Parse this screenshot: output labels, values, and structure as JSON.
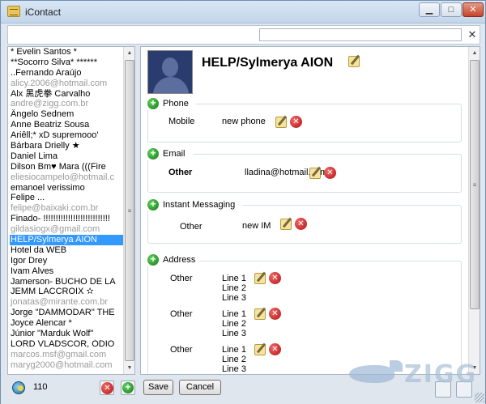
{
  "window": {
    "title": "iContact"
  },
  "search": {
    "value": "",
    "clear_icon": "close-icon"
  },
  "contacts": [
    {
      "label": "* Evelin Santos *",
      "type": "name"
    },
    {
      "label": "**Socorro Silva* ******",
      "type": "name"
    },
    {
      "label": "..Fernando Araújo",
      "type": "name"
    },
    {
      "label": "alicy.2006@hotmail.com",
      "type": "email"
    },
    {
      "label": "Alx 黑虎拳 Carvalho",
      "type": "name"
    },
    {
      "label": "andre@zigg.com.br",
      "type": "email"
    },
    {
      "label": "Ângelo Sednem",
      "type": "name"
    },
    {
      "label": "Anne Beatriz Sousa",
      "type": "name"
    },
    {
      "label": "Ariêll;* xD supremooo'",
      "type": "name"
    },
    {
      "label": "Bárbara Drielly ★",
      "type": "name"
    },
    {
      "label": "Daniel Lima",
      "type": "name"
    },
    {
      "label": "Dilson Bm♥ Mara (((Fire",
      "type": "name"
    },
    {
      "label": "eliesiocampelo@hotmail.c",
      "type": "email"
    },
    {
      "label": "emanoel verissimo",
      "type": "name"
    },
    {
      "label": "Felipe ...",
      "type": "name"
    },
    {
      "label": "felipe@baixaki.com.br",
      "type": "email"
    },
    {
      "label": "Finado- !!!!!!!!!!!!!!!!!!!!!!!!!!!",
      "type": "name"
    },
    {
      "label": "gildasiogx@gmail.com",
      "type": "email"
    },
    {
      "label": "HELP/Sylmerya AION",
      "type": "selected"
    },
    {
      "label": "Hotel da WEB",
      "type": "name"
    },
    {
      "label": "Igor Drey",
      "type": "name"
    },
    {
      "label": "Ivam Alves",
      "type": "name"
    },
    {
      "label": "Jamerson- BUCHO DE LA",
      "type": "name"
    },
    {
      "label": "JEMM LACCROIX ✫",
      "type": "name"
    },
    {
      "label": "jonatas@mirante.com.br",
      "type": "email"
    },
    {
      "label": "Jorge \"DAMMODAR\" THE",
      "type": "name"
    },
    {
      "label": "Joyce Alencar *",
      "type": "name"
    },
    {
      "label": "Júnior \"Marduk Wolf\"",
      "type": "name"
    },
    {
      "label": "LORD VLADSCOR, ÓDIO",
      "type": "name"
    },
    {
      "label": "marcos.msf@gmail.com",
      "type": "email"
    },
    {
      "label": "maryg2000@hotmail.com",
      "type": "email"
    }
  ],
  "detail": {
    "name": "HELP/Sylmerya AION",
    "sections": {
      "phone": {
        "title": "Phone",
        "label": "Mobile",
        "value": "new phone"
      },
      "email": {
        "title": "Email",
        "label": "Other",
        "value": "lladina@hotmail.com"
      },
      "im": {
        "title": "Instant Messaging",
        "label": "Other",
        "value": "new IM"
      },
      "address": {
        "title": "Address",
        "entries": [
          {
            "label": "Other",
            "line1": "Line 1",
            "line2": "Line 2",
            "line3": "Line 3"
          },
          {
            "label": "Other",
            "line1": "Line 1",
            "line2": "Line 2",
            "line3": "Line 3"
          },
          {
            "label": "Other",
            "line1": "Line 1",
            "line2": "Line 2",
            "line3": "Line 3"
          }
        ]
      }
    }
  },
  "bottom": {
    "count": "110",
    "save_label": "Save",
    "cancel_label": "Cancel",
    "watermark": "ZIGG"
  },
  "colors": {
    "selection": "#3399ff",
    "delete": "#c8141a",
    "add": "#1e8a1e",
    "email_text": "#9a9a9a"
  }
}
